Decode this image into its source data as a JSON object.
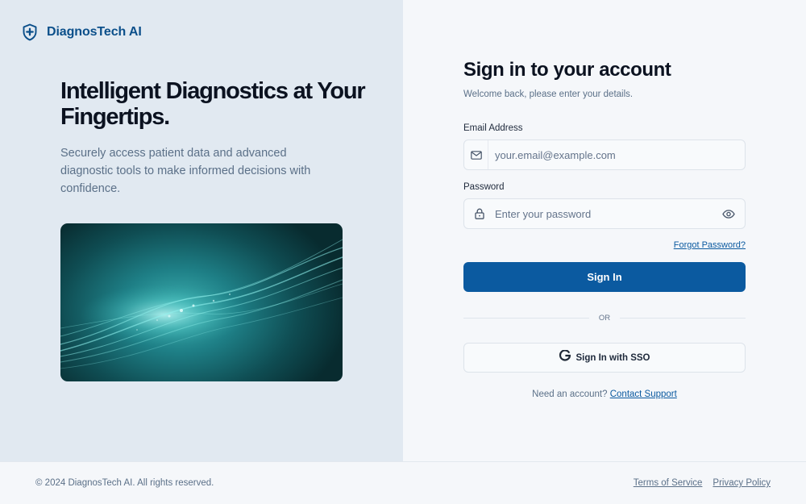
{
  "brand": {
    "name": "DiagnosTech AI",
    "icon": "shield-plus-icon",
    "color": "#0b4f8a"
  },
  "hero": {
    "title": "Intelligent Diagnostics at Your Fingertips.",
    "subtitle": "Securely access patient data and advanced diagnostic tools to make informed decisions with confidence.",
    "image": "abstract-teal-light-waves"
  },
  "form": {
    "title": "Sign in to your account",
    "subtitle": "Welcome back, please enter your details.",
    "email": {
      "label": "Email Address",
      "placeholder": "your.email@example.com",
      "value": "",
      "icon": "mail-icon"
    },
    "password": {
      "label": "Password",
      "placeholder": "Enter your password",
      "value": "",
      "icon": "lock-icon",
      "toggle_icon": "eye-icon"
    },
    "forgot_label": "Forgot Password?",
    "sign_in_label": "Sign In",
    "divider_label": "OR",
    "sso_label": "Sign In with SSO",
    "sso_icon": "google-icon",
    "need_account_text": "Need an account?",
    "contact_label": "Contact Support"
  },
  "footer": {
    "copyright": "© 2024 DiagnosTech AI. All rights reserved.",
    "links": [
      "Terms of Service",
      "Privacy Policy"
    ]
  },
  "colors": {
    "primary": "#0b5aa0",
    "left_panel": "#e1e9f1",
    "background": "#f5f7fa"
  }
}
